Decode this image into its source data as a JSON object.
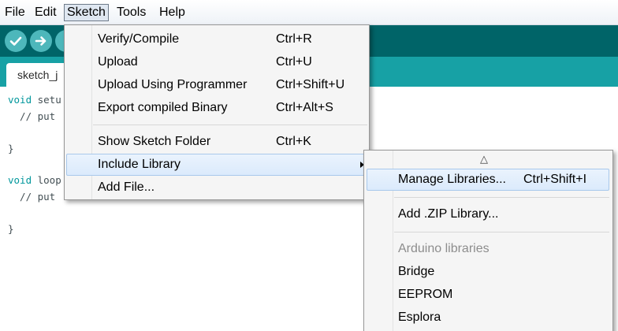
{
  "menubar": {
    "items": [
      "File",
      "Edit",
      "Sketch",
      "Tools",
      "Help"
    ]
  },
  "tab": {
    "label": "sketch_j"
  },
  "editor": {
    "lines": [
      {
        "kw": "void",
        "rest": " setu"
      },
      {
        "kw": "",
        "rest": "  // put"
      },
      {
        "kw": "",
        "rest": "}"
      },
      {
        "kw": "void",
        "rest": " loop"
      },
      {
        "kw": "",
        "rest": "  // put"
      },
      {
        "kw": "",
        "rest": "}"
      }
    ]
  },
  "sketch_menu": {
    "items": [
      {
        "label": "Verify/Compile",
        "shortcut": "Ctrl+R"
      },
      {
        "label": "Upload",
        "shortcut": "Ctrl+U"
      },
      {
        "label": "Upload Using Programmer",
        "shortcut": "Ctrl+Shift+U"
      },
      {
        "label": "Export compiled Binary",
        "shortcut": "Ctrl+Alt+S"
      },
      {
        "label": "Show Sketch Folder",
        "shortcut": "Ctrl+K"
      },
      {
        "label": "Include Library",
        "shortcut": ""
      },
      {
        "label": "Add File...",
        "shortcut": ""
      }
    ]
  },
  "library_menu": {
    "scroll_up": "△",
    "items": [
      {
        "label": "Manage Libraries...",
        "shortcut": "Ctrl+Shift+I"
      },
      {
        "label": "Add .ZIP Library...",
        "shortcut": ""
      },
      {
        "label": "Arduino libraries",
        "shortcut": ""
      },
      {
        "label": "Bridge",
        "shortcut": ""
      },
      {
        "label": "EEPROM",
        "shortcut": ""
      },
      {
        "label": "Esplora",
        "shortcut": ""
      }
    ]
  },
  "colors": {
    "toolbar": "#006468",
    "tabstrip": "#17a1a5",
    "button": "#4db7bb",
    "keyword": "#00979c"
  }
}
